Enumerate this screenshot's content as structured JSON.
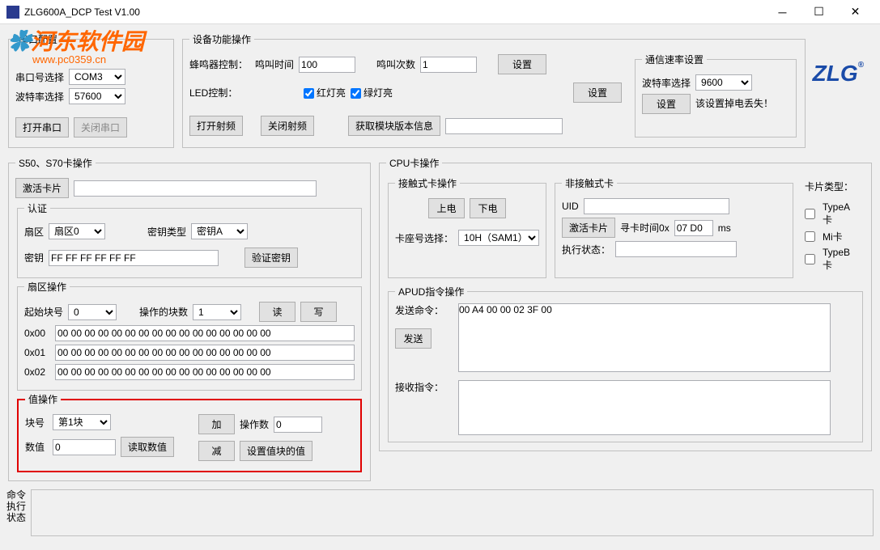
{
  "window": {
    "title": "ZLG600A_DCP Test V1.00"
  },
  "watermark": {
    "text1": "河东软件园",
    "url": "www.pc0359.cn"
  },
  "logo": "ZLG",
  "serial": {
    "legend": "串口配置",
    "port_label": "串口号选择",
    "port_value": "COM3",
    "baud_label": "波特率选择",
    "baud_value": "57600",
    "open_btn": "打开串口",
    "close_btn": "关闭串口"
  },
  "device": {
    "legend": "设备功能操作",
    "buzzer_label": "蜂鸣器控制：",
    "ring_time_label": "鸣叫时间",
    "ring_time_value": "100",
    "ring_count_label": "鸣叫次数",
    "ring_count_value": "1",
    "set_btn": "设置",
    "led_label": "LED控制：",
    "red_led": "红灯亮",
    "green_led": "绿灯亮",
    "open_rf": "打开射频",
    "close_rf": "关闭射频",
    "get_version": "获取模块版本信息",
    "comm_legend": "通信速率设置",
    "baud_sel_label": "波特率选择",
    "baud_sel_value": "9600",
    "comm_set_btn": "设置",
    "comm_note": "该设置掉电丢失！"
  },
  "s50s70": {
    "legend": "S50、S70卡操作",
    "activate": "激活卡片",
    "auth_legend": "认证",
    "sector_label": "扇区",
    "sector_value": "扇区0",
    "key_type_label": "密钥类型",
    "key_type_value": "密钥A",
    "key_label": "密钥",
    "key_value": "FF FF FF FF FF FF",
    "verify_key": "验证密钥",
    "sector_op_legend": "扇区操作",
    "start_block_label": "起始块号",
    "start_block_value": "0",
    "op_blocks_label": "操作的块数",
    "op_blocks_value": "1",
    "read_btn": "读",
    "write_btn": "写",
    "rows": [
      {
        "addr": "0x00",
        "data": "00 00 00 00 00 00 00 00 00 00 00 00 00 00 00 00"
      },
      {
        "addr": "0x01",
        "data": "00 00 00 00 00 00 00 00 00 00 00 00 00 00 00 00"
      },
      {
        "addr": "0x02",
        "data": "00 00 00 00 00 00 00 00 00 00 00 00 00 00 00 00"
      }
    ],
    "value_op_legend": "值操作",
    "block_no_label": "块号",
    "block_no_value": "第1块",
    "value_label": "数值",
    "value_value": "0",
    "read_value": "读取数值",
    "add_btn": "加",
    "sub_btn": "减",
    "op_count_label": "操作数",
    "op_count_value": "0",
    "set_block_value": "设置值块的值"
  },
  "cpu": {
    "legend": "CPU卡操作",
    "contact_legend": "接触式卡操作",
    "power_on": "上电",
    "power_off": "下电",
    "slot_label": "卡座号选择：",
    "slot_value": "10H（SAM1）",
    "contactless_legend": "非接触式卡",
    "uid_label": "UID",
    "activate": "激活卡片",
    "seek_time_label": "寻卡时间0x",
    "seek_time_value": "07 D0",
    "ms_label": "ms",
    "exec_status_label": "执行状态：",
    "card_type_label": "卡片类型：",
    "type_a": "TypeA卡",
    "type_mi": "Mi卡",
    "type_b": "TypeB卡",
    "apdu_legend": "APUD指令操作",
    "send_cmd_label": "发送命令：",
    "send_cmd_value": "00 A4 00 00 02 3F 00",
    "send_btn": "发送",
    "recv_cmd_label": "接收指令："
  },
  "status": {
    "label": "命令执行状态"
  }
}
